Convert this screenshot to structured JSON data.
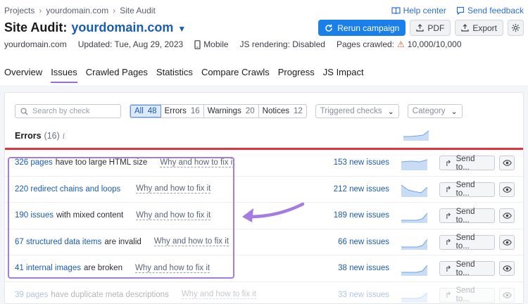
{
  "breadcrumb": [
    "Projects",
    "yourdomain.com",
    "Site Audit"
  ],
  "top_links": {
    "help": "Help center",
    "feedback": "Send feedback"
  },
  "title": {
    "prefix": "Site Audit:",
    "domain": "yourdomain.com"
  },
  "actions": {
    "rerun": "Rerun campaign",
    "pdf": "PDF",
    "export": "Export"
  },
  "meta": {
    "domain": "yourdomain.com",
    "updated": "Updated: Tue, Aug 29, 2023",
    "device": "Mobile",
    "js": "JS rendering: Disabled",
    "crawled_label": "Pages crawled:",
    "crawled_value": "10,000/10,000"
  },
  "tabs": [
    "Overview",
    "Issues",
    "Crawled Pages",
    "Statistics",
    "Compare Crawls",
    "Progress",
    "JS Impact"
  ],
  "active_tab": "Issues",
  "filters": {
    "search_placeholder": "Search by check",
    "segments": [
      {
        "label": "All",
        "count": "48"
      },
      {
        "label": "Errors",
        "count": "16"
      },
      {
        "label": "Warnings",
        "count": "20"
      },
      {
        "label": "Notices",
        "count": "12"
      }
    ],
    "triggered": "Triggered checks",
    "category": "Category"
  },
  "errors_section": {
    "title": "Errors",
    "count": "(16)",
    "info": "i"
  },
  "rows": [
    {
      "link": "326 pages",
      "rest": "have too large HTML size",
      "how": "Why and how to fix it",
      "new": "153 new issues",
      "send": "Send to..."
    },
    {
      "link": "220 redirect chains and loops",
      "rest": "",
      "how": "Why and how to fix it",
      "new": "212 new issues",
      "send": "Send to..."
    },
    {
      "link": "190 issues",
      "rest": "with mixed content",
      "how": "Why and how to fix it",
      "new": "189 new issues",
      "send": "Send to..."
    },
    {
      "link": "67 structured data items",
      "rest": "are invalid",
      "how": "Why and how to fix it",
      "new": "66 new issues",
      "send": "Send to..."
    },
    {
      "link": "41 internal images",
      "rest": "are broken",
      "how": "Why and how to fix it",
      "new": "38 new issues",
      "send": "Send to..."
    },
    {
      "link": "39 pages",
      "rest": "have duplicate meta descriptions",
      "how": "Why and how to fix it",
      "new": "33 new issues",
      "send": "Send to..."
    }
  ],
  "colors": {
    "accent": "#1a7fe8",
    "link": "#1a5bb4",
    "error_line": "#e0343e",
    "highlight": "#a47ce2"
  }
}
